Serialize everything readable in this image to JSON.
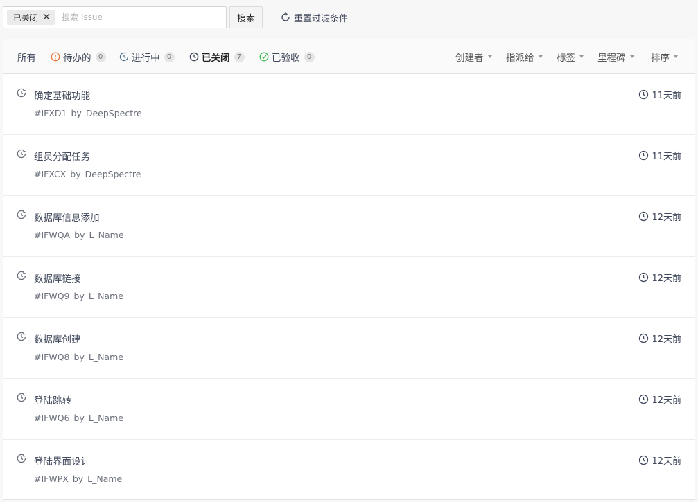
{
  "search": {
    "filter_chip": "已关闭",
    "placeholder": "搜索 Issue",
    "value": "",
    "button_label": "搜索",
    "reset_label": "重置过滤条件"
  },
  "tabs": [
    {
      "label": "所有",
      "count": null,
      "icon": "none"
    },
    {
      "label": "待办的",
      "count": "0",
      "icon": "alert-circle-icon"
    },
    {
      "label": "进行中",
      "count": "0",
      "icon": "in-progress-icon"
    },
    {
      "label": "已关闭",
      "count": "7",
      "icon": "closed-clock-icon",
      "active": true
    },
    {
      "label": "已验收",
      "count": "0",
      "icon": "check-circle-icon"
    }
  ],
  "filters": [
    {
      "label": "创建者"
    },
    {
      "label": "指派给"
    },
    {
      "label": "标签"
    },
    {
      "label": "里程碑"
    },
    {
      "label": "排序"
    }
  ],
  "issues": [
    {
      "title": "确定基础功能",
      "id": "#IFXD1",
      "by": "by",
      "author": "DeepSpectre",
      "time": "11天前"
    },
    {
      "title": "组员分配任务",
      "id": "#IFXCX",
      "by": "by",
      "author": "DeepSpectre",
      "time": "11天前"
    },
    {
      "title": "数据库信息添加",
      "id": "#IFWQA",
      "by": "by",
      "author": "L_Name",
      "time": "12天前"
    },
    {
      "title": "数据库链接",
      "id": "#IFWQ9",
      "by": "by",
      "author": "L_Name",
      "time": "12天前"
    },
    {
      "title": "数据库创建",
      "id": "#IFWQ8",
      "by": "by",
      "author": "L_Name",
      "time": "12天前"
    },
    {
      "title": "登陆跳转",
      "id": "#IFWQ6",
      "by": "by",
      "author": "L_Name",
      "time": "12天前"
    },
    {
      "title": "登陆界面设计",
      "id": "#IFWPX",
      "by": "by",
      "author": "L_Name",
      "time": "12天前"
    }
  ],
  "colors": {
    "todo_icon": "#e8793e",
    "done_icon": "#3fb950",
    "muted_icon": "#6a6f7a",
    "text": "#40485b"
  }
}
